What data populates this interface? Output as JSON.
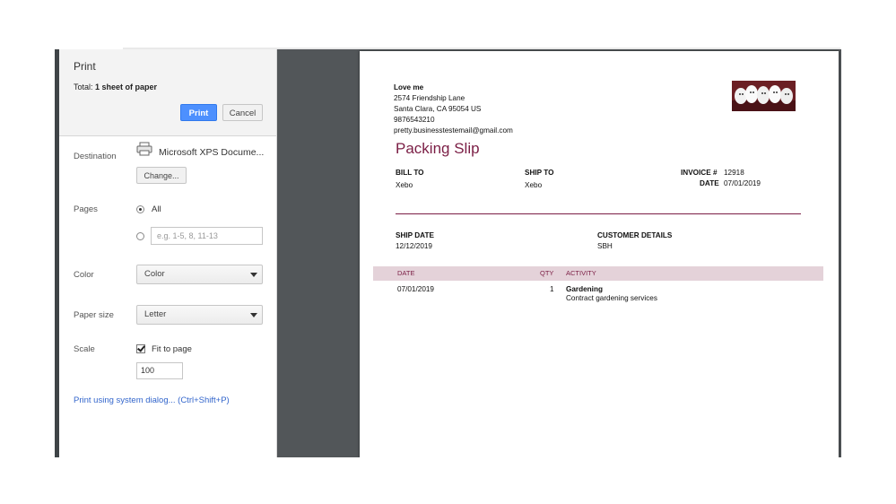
{
  "panel": {
    "title": "Print",
    "total_prefix": "Total: ",
    "total_value": "1 sheet of paper",
    "print_label": "Print",
    "cancel_label": "Cancel",
    "destination_label": "Destination",
    "destination_value": "Microsoft XPS Docume...",
    "change_label": "Change...",
    "pages_label": "Pages",
    "pages_all_label": "All",
    "pages_placeholder": "e.g. 1-5, 8, 11-13",
    "color_label": "Color",
    "color_value": "Color",
    "paper_size_label": "Paper size",
    "paper_size_value": "Letter",
    "scale_label": "Scale",
    "fit_to_page_label": "Fit to page",
    "scale_value": "100",
    "system_dialog_link": "Print using system dialog... (Ctrl+Shift+P)"
  },
  "document": {
    "company_name": "Love me",
    "address_line1": "2574  Friendship Lane",
    "address_line2": "Santa Clara, CA  95054 US",
    "phone": "9876543210",
    "email": "pretty.businesstestemail@gmail.com",
    "title": "Packing Slip",
    "bill_to_label": "BILL TO",
    "bill_to_value": "Xebo",
    "ship_to_label": "SHIP TO",
    "ship_to_value": "Xebo",
    "invoice_label": "INVOICE #",
    "invoice_value": "12918",
    "date_label": "DATE",
    "date_value": "07/01/2019",
    "ship_date_label": "SHIP DATE",
    "ship_date_value": "12/12/2019",
    "customer_details_label": "CUSTOMER DETAILS",
    "customer_details_value": "SBH",
    "table": {
      "headers": [
        "DATE",
        "QTY",
        "ACTIVITY"
      ],
      "rows": [
        {
          "date": "07/01/2019",
          "qty": "1",
          "activity": "Gardening",
          "description": "Contract gardening services"
        }
      ]
    }
  },
  "colors": {
    "accent": "#7b1e45",
    "primary_button": "#4d90fe",
    "link": "#3366cc",
    "preview_background": "#525659"
  }
}
